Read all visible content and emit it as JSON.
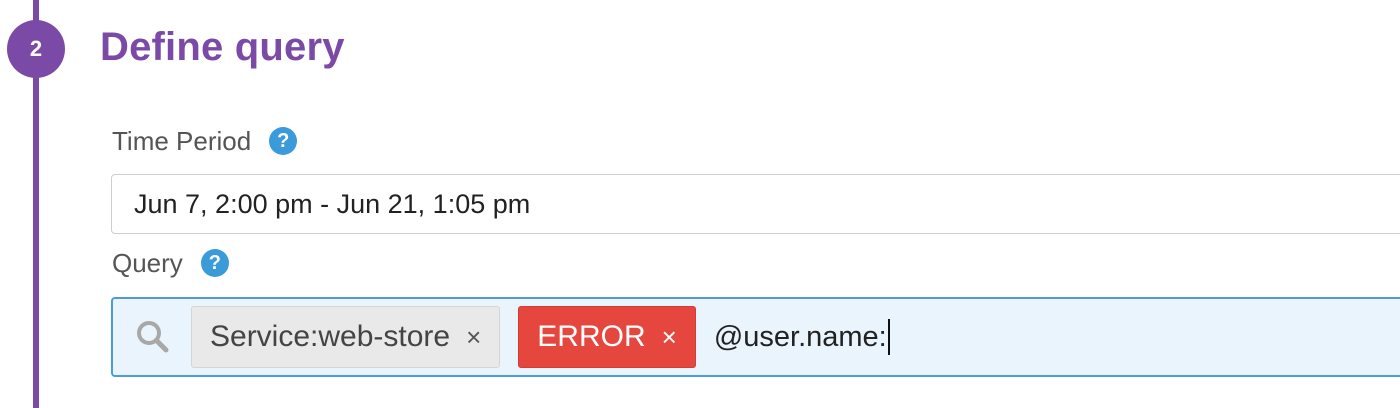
{
  "step": {
    "number": "2",
    "title": "Define query"
  },
  "time_period": {
    "label": "Time Period",
    "help_glyph": "?",
    "value": "Jun 7, 2:00 pm - Jun 21, 1:05 pm"
  },
  "query": {
    "label": "Query",
    "help_glyph": "?",
    "chips": [
      {
        "text": "Service:web-store",
        "remove_glyph": "×"
      },
      {
        "text": "ERROR",
        "remove_glyph": "×"
      }
    ],
    "input_text": "@user.name:"
  },
  "icons": {
    "help": "question-circle-icon",
    "search": "magnifier-icon",
    "remove": "close-x-icon"
  },
  "colors": {
    "accent": "#7b4aa6",
    "help": "#3b9ad9",
    "error_chip": "#e5473f",
    "service_chip": "#e9e9e9",
    "query_focus_border": "#4a9dd6",
    "query_background": "#eaf4fc"
  }
}
